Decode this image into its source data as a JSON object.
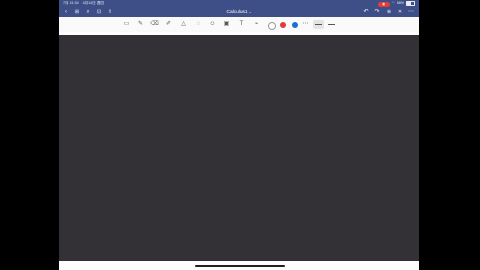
{
  "status_bar": {
    "time": "7月 41:34",
    "date": "4月14日 週四",
    "record_label": "◉",
    "battery_percent": "58%",
    "battery_level": 0.58
  },
  "nav": {
    "title": "Calculus1",
    "title_caret": "⌄",
    "back_icon": "‹",
    "grid_icon": "⊞",
    "search_icon": "⌕",
    "bookmark_icon": "⊡",
    "share_icon": "⇧",
    "undo_icon": "↶",
    "redo_icon": "↷",
    "add_page_icon": "⊕",
    "close_icon": "✕",
    "more_icon": "⋯"
  },
  "toolbar": {
    "tools": [
      {
        "name": "read-only-icon",
        "glyph": "▭"
      },
      {
        "name": "pen-icon",
        "glyph": "✎"
      },
      {
        "name": "eraser-icon",
        "glyph": "⌫"
      },
      {
        "name": "highlighter-icon",
        "glyph": "✐"
      },
      {
        "name": "shapes-icon",
        "glyph": "△"
      },
      {
        "name": "lasso-icon",
        "glyph": "◌"
      },
      {
        "name": "sticker-icon",
        "glyph": "☺"
      },
      {
        "name": "image-icon",
        "glyph": "▣"
      },
      {
        "name": "text-icon",
        "glyph": "T"
      },
      {
        "name": "laser-pointer-icon",
        "glyph": "⌁"
      }
    ],
    "colors": [
      "#ffffff",
      "#e03a3a",
      "#1b6fd6"
    ],
    "more_icon": "⋯"
  },
  "colors": {
    "status_bar_bg": "#3d4f86",
    "canvas_bg": "#333036",
    "toolbar_bg": "#fafafa"
  }
}
